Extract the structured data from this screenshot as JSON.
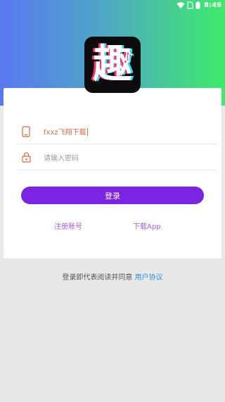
{
  "status_bar": {
    "time": "8:49"
  },
  "login": {
    "phone_value": "fxxz飞翔下载",
    "password_placeholder": "请输入密码",
    "login_button": "登录",
    "register_link": "注册账号",
    "download_link": "下载App"
  },
  "agreement": {
    "text": "登录即代表阅读并同意 ",
    "link": "用户协议"
  },
  "colors": {
    "gradient_start": "#5a78f2",
    "gradient_end": "#3fea6a",
    "button": "#7b24e3",
    "link": "#a65ee0",
    "agreement_link": "#2d8fe0"
  },
  "logo": {
    "glyph": "趣"
  }
}
